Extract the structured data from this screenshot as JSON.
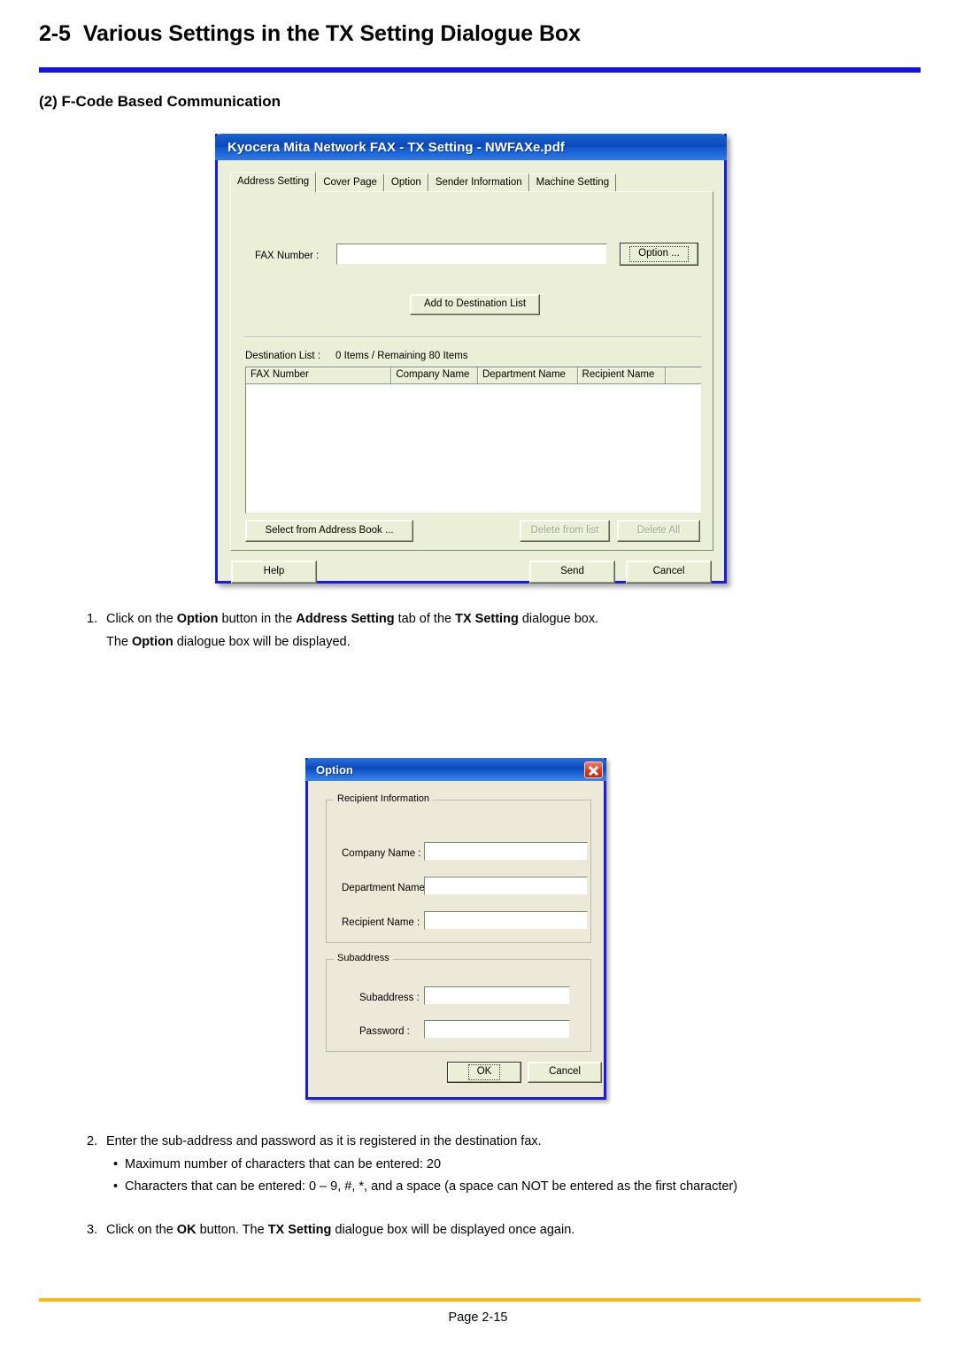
{
  "header": {
    "section_number": "2-5",
    "title": "Various Settings in the TX Setting Dialogue Box",
    "subheading": "(2) F-Code Based Communication",
    "rule_color": "#1414e6"
  },
  "tx_dialog": {
    "title": "Kyocera Mita Network FAX - TX Setting - NWFAXe.pdf",
    "tabs": [
      {
        "label": "Address Setting",
        "active": true
      },
      {
        "label": "Cover Page",
        "active": false
      },
      {
        "label": "Option",
        "active": false
      },
      {
        "label": "Sender Information",
        "active": false
      },
      {
        "label": "Machine Setting",
        "active": false
      }
    ],
    "fax_number_label": "FAX Number :",
    "fax_number_value": "",
    "option_button": "Option ...",
    "add_button": "Add to Destination List",
    "destination_list_label": "Destination List :",
    "destination_list_count": "0 Items / Remaining 80 Items",
    "columns": [
      "FAX Number",
      "Company Name",
      "Department Name",
      "Recipient Name",
      ""
    ],
    "rows": [],
    "select_address_book_button": "Select from Address Book ...",
    "delete_from_list_button": "Delete from list",
    "delete_all_button": "Delete All",
    "help_button": "Help",
    "send_button": "Send",
    "cancel_button": "Cancel"
  },
  "option_dialog": {
    "title": "Option",
    "close_icon": "close-icon",
    "recipient_group_title": "Recipient Information",
    "company_name_label": "Company Name :",
    "company_name_value": "",
    "department_name_label": "Department Name :",
    "department_name_value": "",
    "recipient_name_label": "Recipient Name :",
    "recipient_name_value": "",
    "subaddress_group_title": "Subaddress",
    "subaddress_label": "Subaddress :",
    "subaddress_value": "",
    "password_label": "Password :",
    "password_value": "",
    "ok_button": "OK",
    "cancel_button": "Cancel"
  },
  "steps": {
    "step1_num": "1.",
    "step1_a_1": "Click on the ",
    "step1_a_b1": "Option",
    "step1_a_2": " button in the ",
    "step1_a_b2": "Address Setting",
    "step1_a_3": " tab of the ",
    "step1_a_b3": "TX Setting",
    "step1_a_4": " dialogue box.",
    "step1_b_1": "The ",
    "step1_b_b1": "Option",
    "step1_b_2": " dialogue box will be displayed.",
    "step2_num": "2.",
    "step2_text": "Enter the sub-address and password as it is registered in the destination fax.",
    "bullet_char": "•",
    "bullet1": "Maximum number of characters that can be entered: 20",
    "bullet2": "Characters that can be entered: 0 – 9, #, *, and a space (a space can NOT be entered as the first character)",
    "step3_num": "3.",
    "step3_1": "Click on the ",
    "step3_b1": "OK",
    "step3_2": " button. The ",
    "step3_b2": "TX Setting",
    "step3_3": " dialogue box will be displayed once again."
  },
  "footer": {
    "page_label": "Page 2-15",
    "rule_color": "#f5b816"
  }
}
